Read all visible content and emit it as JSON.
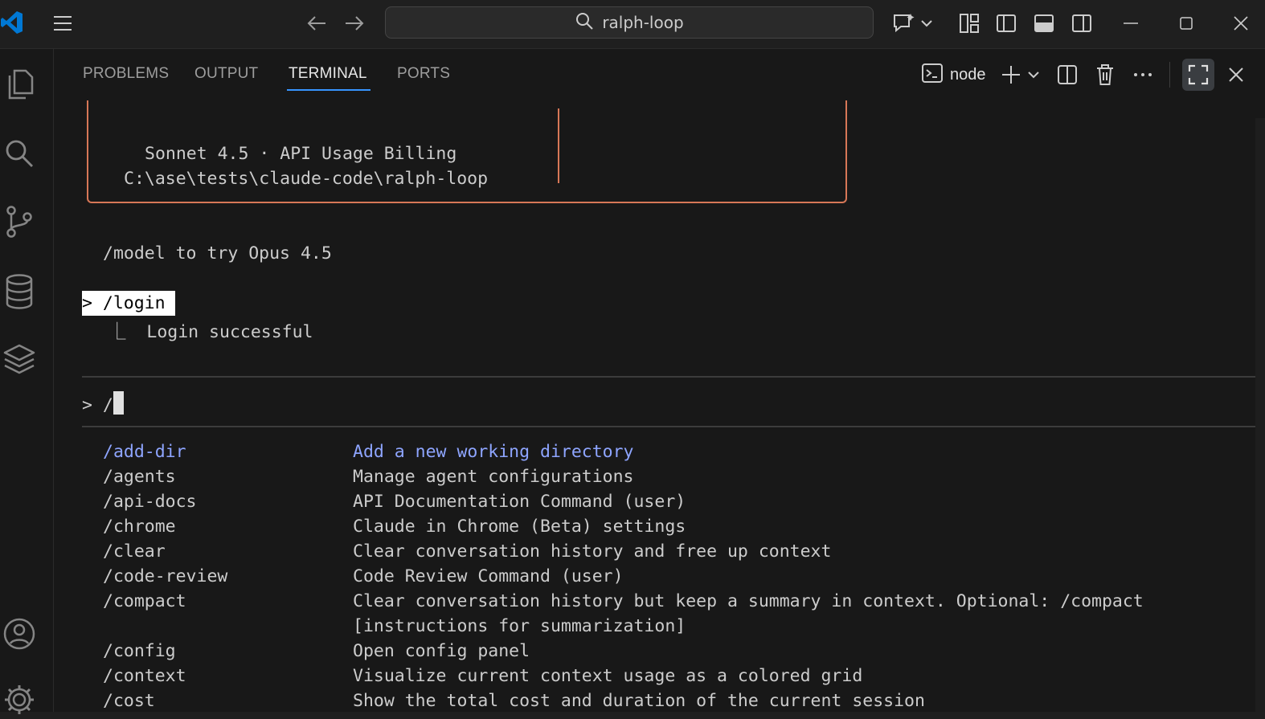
{
  "window": {
    "search_text": "ralph-loop"
  },
  "titlebar_icons": [
    "vscode-logo-icon",
    "menu-icon",
    "back-arrow-icon",
    "forward-arrow-icon",
    "copilot-chat-icon",
    "chevron-down-icon",
    "customize-layout-icon",
    "toggle-primary-sidebar-icon",
    "toggle-panel-icon",
    "toggle-secondary-sidebar-icon",
    "minimize-icon",
    "maximize-icon",
    "close-icon"
  ],
  "activity_icons": [
    "explorer-icon",
    "search-icon",
    "source-control-icon",
    "database-icon",
    "layers-icon",
    "account-icon",
    "settings-gear-icon"
  ],
  "panel": {
    "tabs": [
      {
        "label": "PROBLEMS",
        "active": false
      },
      {
        "label": "OUTPUT",
        "active": false
      },
      {
        "label": "TERMINAL",
        "active": true
      },
      {
        "label": "PORTS",
        "active": false
      }
    ],
    "terminal_name": "node"
  },
  "terminal": {
    "banner_line1": "Sonnet 4.5 · API Usage Billing",
    "banner_line2": "C:\\ase\\tests\\claude-code\\ralph-loop",
    "model_hint": "/model to try Opus 4.5",
    "prev_prompt": "> /login",
    "prev_result": "⎿  Login successful",
    "input_prefix": "> /",
    "commands": [
      {
        "name": "/add-dir",
        "desc": "Add a new working directory",
        "selected": true
      },
      {
        "name": "/agents",
        "desc": "Manage agent configurations"
      },
      {
        "name": "/api-docs",
        "desc": "API Documentation Command (user)"
      },
      {
        "name": "/chrome",
        "desc": "Claude in Chrome (Beta) settings"
      },
      {
        "name": "/clear",
        "desc": "Clear conversation history and free up context"
      },
      {
        "name": "/code-review",
        "desc": "Code Review Command (user)"
      },
      {
        "name": "/compact",
        "desc": "Clear conversation history but keep a summary in context. Optional: /compact"
      },
      {
        "name": "",
        "desc": "[instructions for summarization]"
      },
      {
        "name": "/config",
        "desc": "Open config panel"
      },
      {
        "name": "/context",
        "desc": "Visualize current context usage as a colored grid"
      },
      {
        "name": "/cost",
        "desc": "Show the total cost and duration of the current session"
      }
    ]
  },
  "colors": {
    "accent": "#3794ff",
    "banner_border": "#d77757",
    "selected_command": "#8ea5ff",
    "vscode_logo": "#0078d4"
  }
}
